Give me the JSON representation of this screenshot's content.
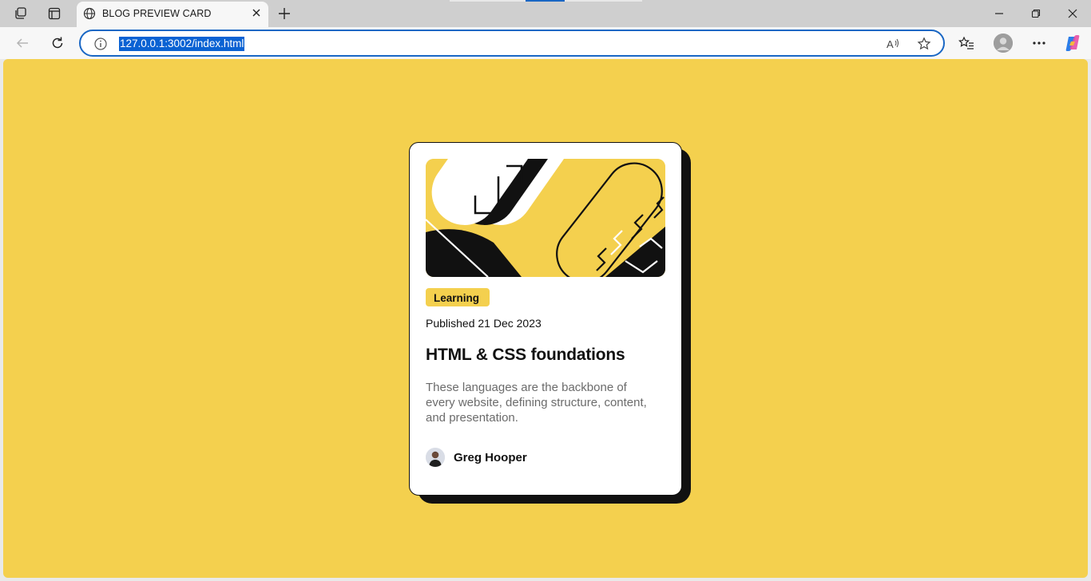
{
  "browser": {
    "tab_title": "BLOG PREVIEW CARD",
    "url": "127.0.0.1:3002/index.html",
    "icons": [
      "workspaces-icon",
      "tab-actions-icon",
      "globe-icon",
      "close-tab-icon",
      "new-tab-icon",
      "minimize-icon",
      "restore-icon",
      "close-window-icon",
      "back-icon",
      "refresh-icon",
      "site-info-icon",
      "read-aloud-icon",
      "favorite-star-icon",
      "favorites-icon",
      "profile-icon",
      "more-icon",
      "copilot-icon"
    ]
  },
  "card": {
    "tag": "Learning",
    "published": "Published 21 Dec 2023",
    "title": "HTML & CSS foundations",
    "description": "These languages are the backbone of every website, defining structure, content, and presentation.",
    "author": "Greg Hooper"
  },
  "colors": {
    "page_bg": "#f4d04e",
    "card_bg": "#ffffff",
    "text_dark": "#111111",
    "text_muted": "#6b6b6b",
    "accent_url": "#0a62d3"
  }
}
